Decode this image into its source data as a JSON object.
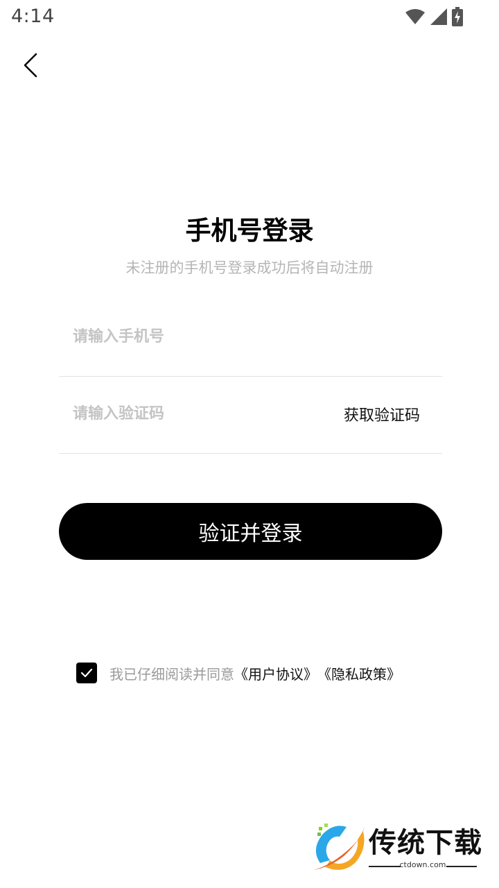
{
  "status_bar": {
    "time": "4:14"
  },
  "header": {
    "back_icon": "chevron-left-icon"
  },
  "title": "手机号登录",
  "subtitle": "未注册的手机号登录成功后将自动注册",
  "form": {
    "phone_placeholder": "请输入手机号",
    "code_placeholder": "请输入验证码",
    "get_code_label": "获取验证码",
    "submit_label": "验证并登录"
  },
  "agreement": {
    "checked": true,
    "prefix": "我已仔细阅读并同意",
    "user_agreement": "《用户协议》",
    "privacy_policy": "《隐私政策》"
  },
  "watermark": {
    "brand": "传统下载",
    "url": "ctdown.com"
  },
  "colors": {
    "primary": "#000000",
    "placeholder": "#c4c4c4",
    "subtitle": "#b5b5b5",
    "divider": "#e2e2e2"
  }
}
